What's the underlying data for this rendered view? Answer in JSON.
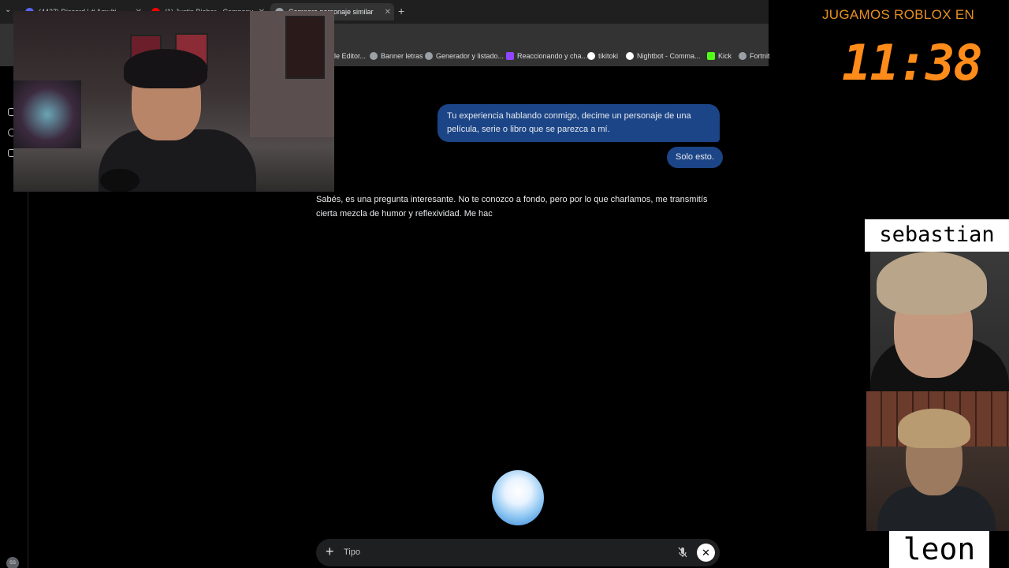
{
  "browser": {
    "tabs": [
      {
        "title": "(4427) Discord | # Amulti...",
        "fav_color": "#5865f2",
        "active": false
      },
      {
        "title": "(1) Justin Bieber - Company...",
        "fav_color": "#ff0000",
        "active": false
      },
      {
        "title": "Compara personaje similar",
        "fav_color": "#9aa0a6",
        "active": true
      }
    ],
    "new_tab": "+",
    "bookmarks": [
      {
        "label": "le Editor...",
        "color": "#4285f4"
      },
      {
        "label": "Banner letras",
        "color": "#9aa0a6"
      },
      {
        "label": "Generador y listado...",
        "color": "#9aa0a6"
      },
      {
        "label": "Reaccionando y cha...",
        "color": "#9146ff"
      },
      {
        "label": "tikitoki",
        "color": "#ffffff"
      },
      {
        "label": "Nightbot - Comma...",
        "color": "#ffffff"
      },
      {
        "label": "Kick",
        "color": "#53fc18"
      },
      {
        "label": "Fortnit",
        "color": "#9aa0a6"
      }
    ]
  },
  "chat": {
    "user_message_1": "Tu experiencia hablando conmigo, decime un personaje de una película, serie o libro que se parezca a mí.",
    "user_message_2": "Solo esto.",
    "assistant_reply": "Sabés, es una pregunta interesante. No te conozco a fondo, pero por lo que charlamos, me transmitís cierta mezcla de humor y reflexividad. Me hac",
    "input_placeholder": "Tipo",
    "plus_icon": "+",
    "close_icon": "✕",
    "user_bubble_color": "#1c4587"
  },
  "overlay": {
    "countdown_title": "JUGAMOS ROBLOX EN",
    "countdown_time": "11:38",
    "countdown_color": "#ff8c1a",
    "label_top": "sebastian",
    "label_bottom": "leon"
  },
  "sidebar": {
    "avatar_initials": "SS"
  }
}
